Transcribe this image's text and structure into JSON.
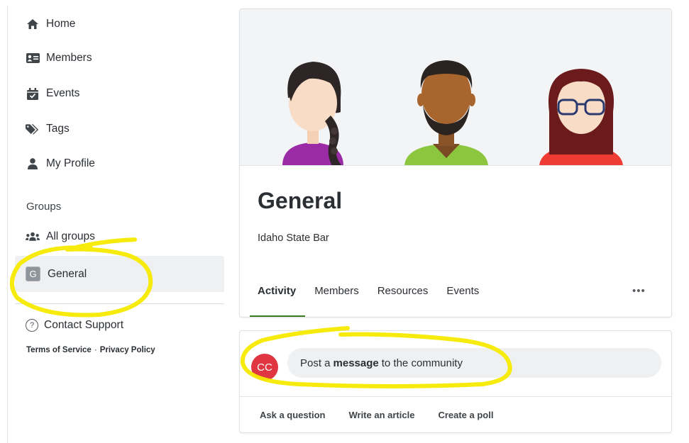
{
  "sidebar": {
    "nav": [
      {
        "label": "Home",
        "icon": "home-icon"
      },
      {
        "label": "Members",
        "icon": "id-card-icon"
      },
      {
        "label": "Events",
        "icon": "calendar-check-icon"
      },
      {
        "label": "Tags",
        "icon": "tags-icon"
      },
      {
        "label": "My Profile",
        "icon": "user-icon"
      }
    ],
    "groups_label": "Groups",
    "all_groups": {
      "label": "All groups",
      "icon": "users-icon"
    },
    "general": {
      "badge": "G",
      "label": "General"
    },
    "support": {
      "label": "Contact Support",
      "icon": "question-circle-icon"
    },
    "terms": "Terms of Service",
    "separator": "·",
    "privacy": "Privacy Policy"
  },
  "group": {
    "title": "General",
    "subtitle": "Idaho State Bar",
    "tabs": [
      "Activity",
      "Members",
      "Resources",
      "Events"
    ],
    "active_tab": "Activity",
    "more": "•••"
  },
  "composer": {
    "avatar_initials": "CC",
    "prompt_before": "Post a",
    "prompt_bold": "message",
    "prompt_after": "to the community",
    "actions": [
      "Ask a question",
      "Write an article",
      "Create a poll"
    ]
  },
  "colors": {
    "accent": "#3e7d1f",
    "avatar": "#e03642",
    "annotation": "#f5ea00"
  }
}
